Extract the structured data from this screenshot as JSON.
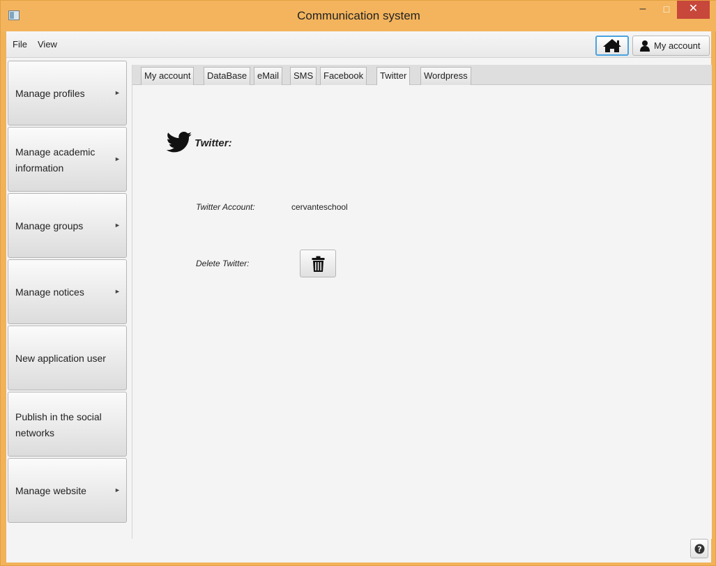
{
  "window": {
    "title": "Communication system",
    "minimize": "–",
    "maximize": "□",
    "close": "✕"
  },
  "menu": {
    "file": "File",
    "view": "View"
  },
  "toolbar": {
    "my_account": "My account"
  },
  "sidebar": {
    "items": [
      {
        "label": "Manage profiles",
        "arrow": "►"
      },
      {
        "label": "Manage academic information",
        "arrow": "►"
      },
      {
        "label": "Manage groups",
        "arrow": "►"
      },
      {
        "label": "Manage notices",
        "arrow": "►"
      },
      {
        "label": "New application user",
        "arrow": ""
      },
      {
        "label": "Publish in the social networks",
        "arrow": ""
      },
      {
        "label": "Manage website",
        "arrow": "►"
      }
    ]
  },
  "tabs": {
    "items": [
      "My account",
      "DataBase",
      "eMail",
      "SMS",
      "Facebook",
      "Twitter",
      "Wordpress"
    ],
    "active": "Twitter"
  },
  "twitter": {
    "heading": "Twitter:",
    "account_label": "Twitter Account:",
    "account_value": "cervanteschool",
    "delete_label": "Delete Twitter:"
  },
  "icons": {
    "home": "home-icon",
    "user": "user-icon",
    "twitter": "twitter-bird-icon",
    "trash": "trash-icon",
    "help": "help-icon"
  },
  "colors": {
    "title_bar": "#f3b45d",
    "close_button": "#c7473a",
    "focus_ring": "#4aa3df"
  }
}
